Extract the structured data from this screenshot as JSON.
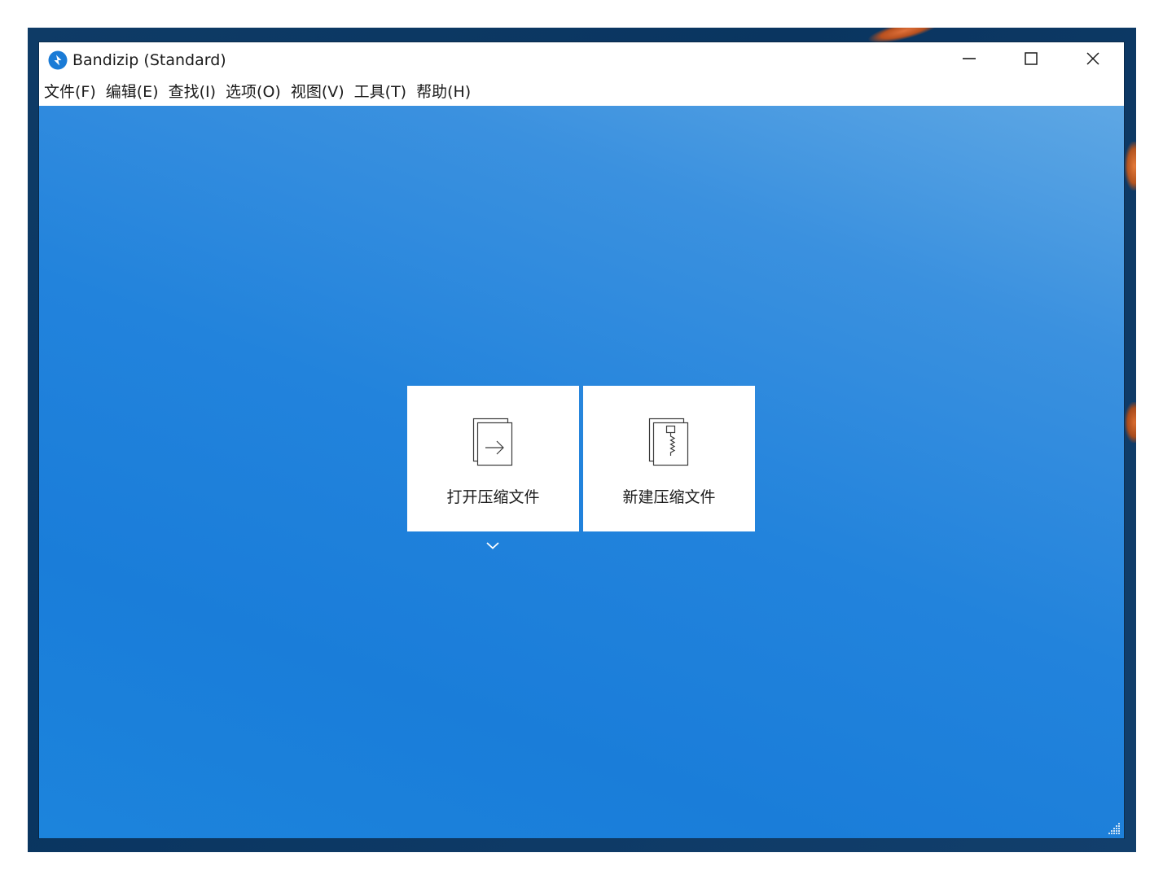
{
  "window": {
    "title": "Bandizip (Standard)",
    "app_icon": "bandizip-logo-icon",
    "controls": {
      "minimize": "minimize-icon",
      "maximize": "maximize-icon",
      "close": "close-icon"
    }
  },
  "menubar": {
    "items": [
      {
        "label": "文件(F)"
      },
      {
        "label": "编辑(E)"
      },
      {
        "label": "查找(I)"
      },
      {
        "label": "选项(O)"
      },
      {
        "label": "视图(V)"
      },
      {
        "label": "工具(T)"
      },
      {
        "label": "帮助(H)"
      }
    ]
  },
  "main": {
    "tiles": [
      {
        "label": "打开压缩文件",
        "icon": "open-archive-icon"
      },
      {
        "label": "新建压缩文件",
        "icon": "new-archive-icon"
      }
    ],
    "more_icon": "chevron-down-icon"
  },
  "colors": {
    "accent_blue": "#1f7fda",
    "app_icon_blue": "#1a7bd6",
    "tile_background": "#ffffff",
    "text": "#1b1b1b"
  }
}
